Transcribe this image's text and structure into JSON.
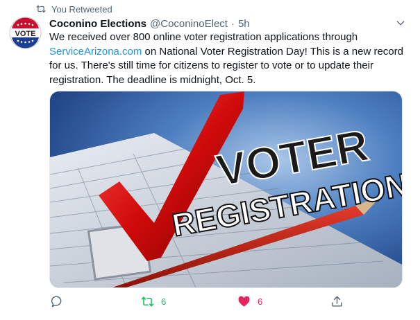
{
  "context": {
    "label": "You Retweeted",
    "icon": "retweet-icon"
  },
  "author": {
    "display_name": "Coconino Elections",
    "handle": "@CoconinoElect",
    "separator": "·",
    "time": "5h",
    "avatar_text": "VOTE"
  },
  "text": {
    "part1": "We received over 800 online voter registration applications through ",
    "link": "ServiceArizona.com",
    "part2": " on National Voter Registration Day! This is a new record for us. There's still time for citizens to register to vote or to update their registration. The deadline is midnight, Oct. 5."
  },
  "media": {
    "headline_top": "VOTER",
    "headline_bottom": "REGISTRATION"
  },
  "actions": {
    "reply_count": "",
    "retweet_count": "6",
    "like_count": "6"
  },
  "colors": {
    "retweeted": "#17bf63",
    "liked": "#e0245e",
    "link": "#1b95e0",
    "muted": "#536471"
  }
}
